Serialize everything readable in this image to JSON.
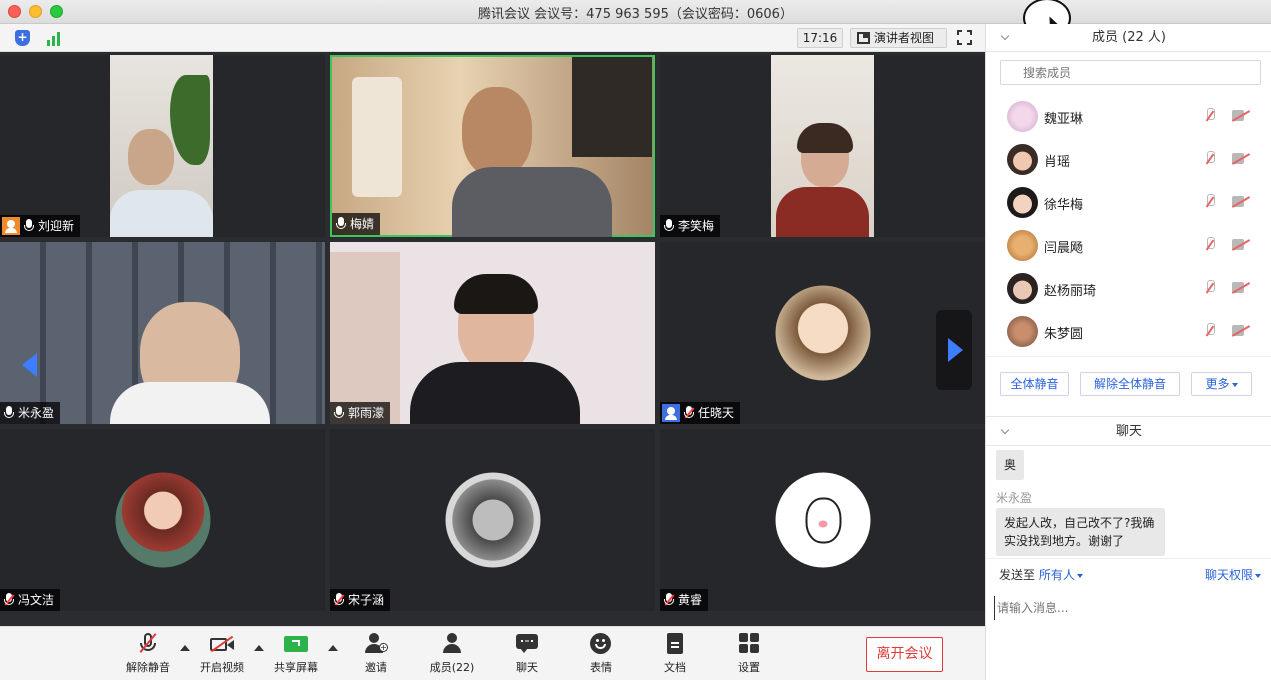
{
  "window": {
    "title": "腾讯会议 会议号：475 963 595（会议密码：0606）"
  },
  "topbar": {
    "time": "17:16",
    "view_label": "演讲者视图"
  },
  "tiles": [
    {
      "name": "刘迎新",
      "muted": false,
      "badge": "host"
    },
    {
      "name": "梅婧",
      "muted": false,
      "badge": "",
      "active": true
    },
    {
      "name": "李笑梅",
      "muted": false,
      "badge": ""
    },
    {
      "name": "米永盈",
      "muted": false,
      "badge": ""
    },
    {
      "name": "郭雨濛",
      "muted": false,
      "badge": ""
    },
    {
      "name": "任晓天",
      "muted": true,
      "badge": "user"
    },
    {
      "name": "冯文洁",
      "muted": true,
      "badge": ""
    },
    {
      "name": "宋子涵",
      "muted": true,
      "badge": ""
    },
    {
      "name": "黄睿",
      "muted": true,
      "badge": ""
    }
  ],
  "toolbar": {
    "unmute": "解除静音",
    "start_video": "开启视频",
    "share_screen": "共享屏幕",
    "invite": "邀请",
    "members": "成员(22)",
    "chat": "聊天",
    "reactions": "表情",
    "docs": "文档",
    "settings": "设置",
    "leave": "离开会议"
  },
  "sidebar": {
    "members_header": "成员 (22 人)",
    "search_placeholder": "搜索成员",
    "members": [
      {
        "name": "魏亚琳"
      },
      {
        "name": "肖瑶"
      },
      {
        "name": "徐华梅"
      },
      {
        "name": "闫晨飏"
      },
      {
        "name": "赵杨丽琦"
      },
      {
        "name": "朱梦圆"
      }
    ],
    "mute_all": "全体静音",
    "unmute_all": "解除全体静音",
    "more": "更多",
    "chat_header": "聊天",
    "messages": [
      {
        "sender": "",
        "text": "奥"
      },
      {
        "sender": "米永盈",
        "text": "发起人改，自己改不了?我确实没找到地方。谢谢了"
      }
    ],
    "send_to_label": "发送至",
    "send_to_value": "所有人",
    "chat_permission": "聊天权限",
    "input_placeholder": "请输入消息..."
  },
  "colors": {
    "accent": "#2b63d9",
    "active_border": "#3bc75a",
    "leave_red": "#e03b3b",
    "host_badge": "#f08a2a"
  }
}
